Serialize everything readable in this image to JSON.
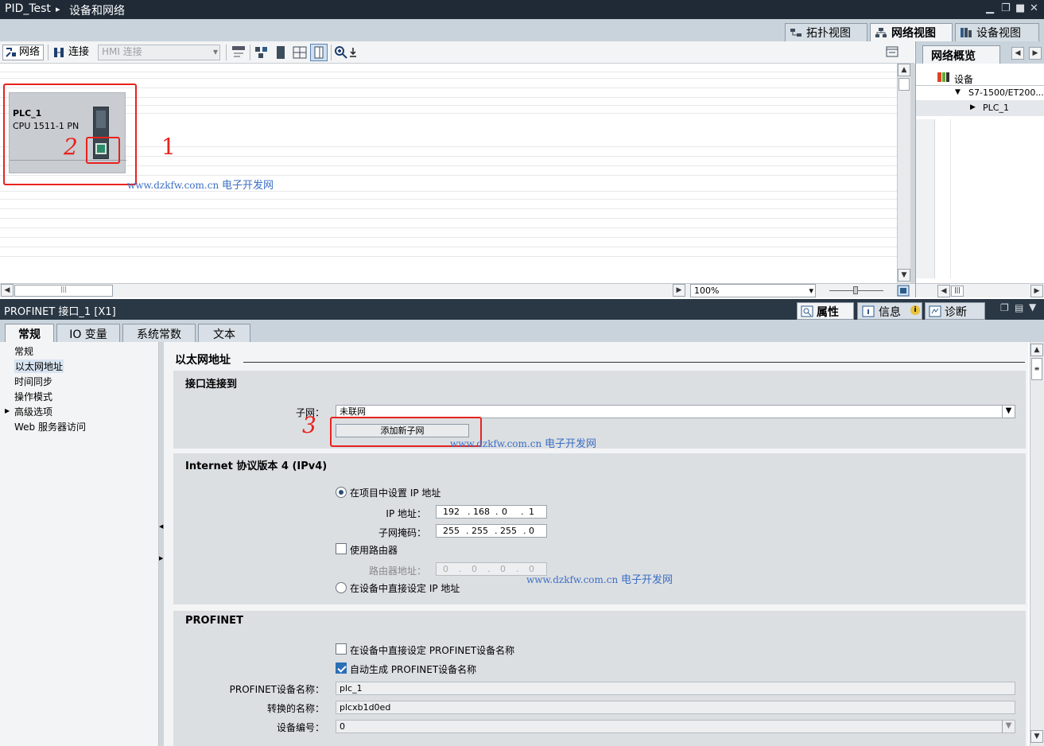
{
  "title": {
    "project": "PID_Test",
    "separator": "▸",
    "page": "设备和网络"
  },
  "view_tabs": [
    {
      "label": "拓扑视图",
      "icon": "topology-icon"
    },
    {
      "label": "网络视图",
      "icon": "network-icon"
    },
    {
      "label": "设备视图",
      "icon": "device-icon"
    }
  ],
  "toolbar": {
    "network_label": "网络",
    "connect_label": "连接",
    "hmi_select": "HMI 连接"
  },
  "device": {
    "name": "PLC_1",
    "type": "CPU 1511-1 PN"
  },
  "annotations": {
    "n1": "1",
    "n2": "2",
    "n3": "3"
  },
  "watermark": {
    "url": "www.dzkfw.com.cn",
    "site": "电子开发网"
  },
  "zoom": "100%",
  "overview": {
    "tab": "网络概览",
    "header": "设备",
    "rows": [
      "S7-1500/ET200...",
      "PLC_1"
    ]
  },
  "props_header": {
    "title": "PROFINET 接口_1 [X1]",
    "tabs": [
      "属性",
      "信息",
      "诊断"
    ]
  },
  "prop_tabs": [
    "常规",
    "IO 变量",
    "系统常数",
    "文本"
  ],
  "nav": [
    "常规",
    "以太网地址",
    "时间同步",
    "操作模式",
    "高级选项",
    "Web 服务器访问"
  ],
  "content": {
    "heading": "以太网地址",
    "interface": {
      "title": "接口连接到",
      "subnet_label": "子网：",
      "subnet_value": "未联网",
      "add_subnet": "添加新子网"
    },
    "ipv4": {
      "title": "Internet 协议版本 4 (IPv4)",
      "opt_project": "在项目中设置 IP 地址",
      "ip_label": "IP 地址：",
      "ip": [
        "192",
        "168",
        "0",
        "1"
      ],
      "mask_label": "子网掩码：",
      "mask": [
        "255",
        "255",
        "255",
        "0"
      ],
      "router_label": "使用路由器",
      "router_addr_label": "路由器地址：",
      "router": [
        "0",
        "0",
        "0",
        "0"
      ],
      "opt_device": "在设备中直接设定 IP 地址"
    },
    "profinet": {
      "title": "PROFINET",
      "opt_device_name": "在设备中直接设定 PROFINET设备名称",
      "opt_auto": "自动生成 PROFINET设备名称",
      "name_label": "PROFINET设备名称：",
      "name_value": "plc_1",
      "conv_label": "转换的名称：",
      "conv_value": "plcxb1d0ed",
      "num_label": "设备编号：",
      "num_value": "0"
    }
  }
}
